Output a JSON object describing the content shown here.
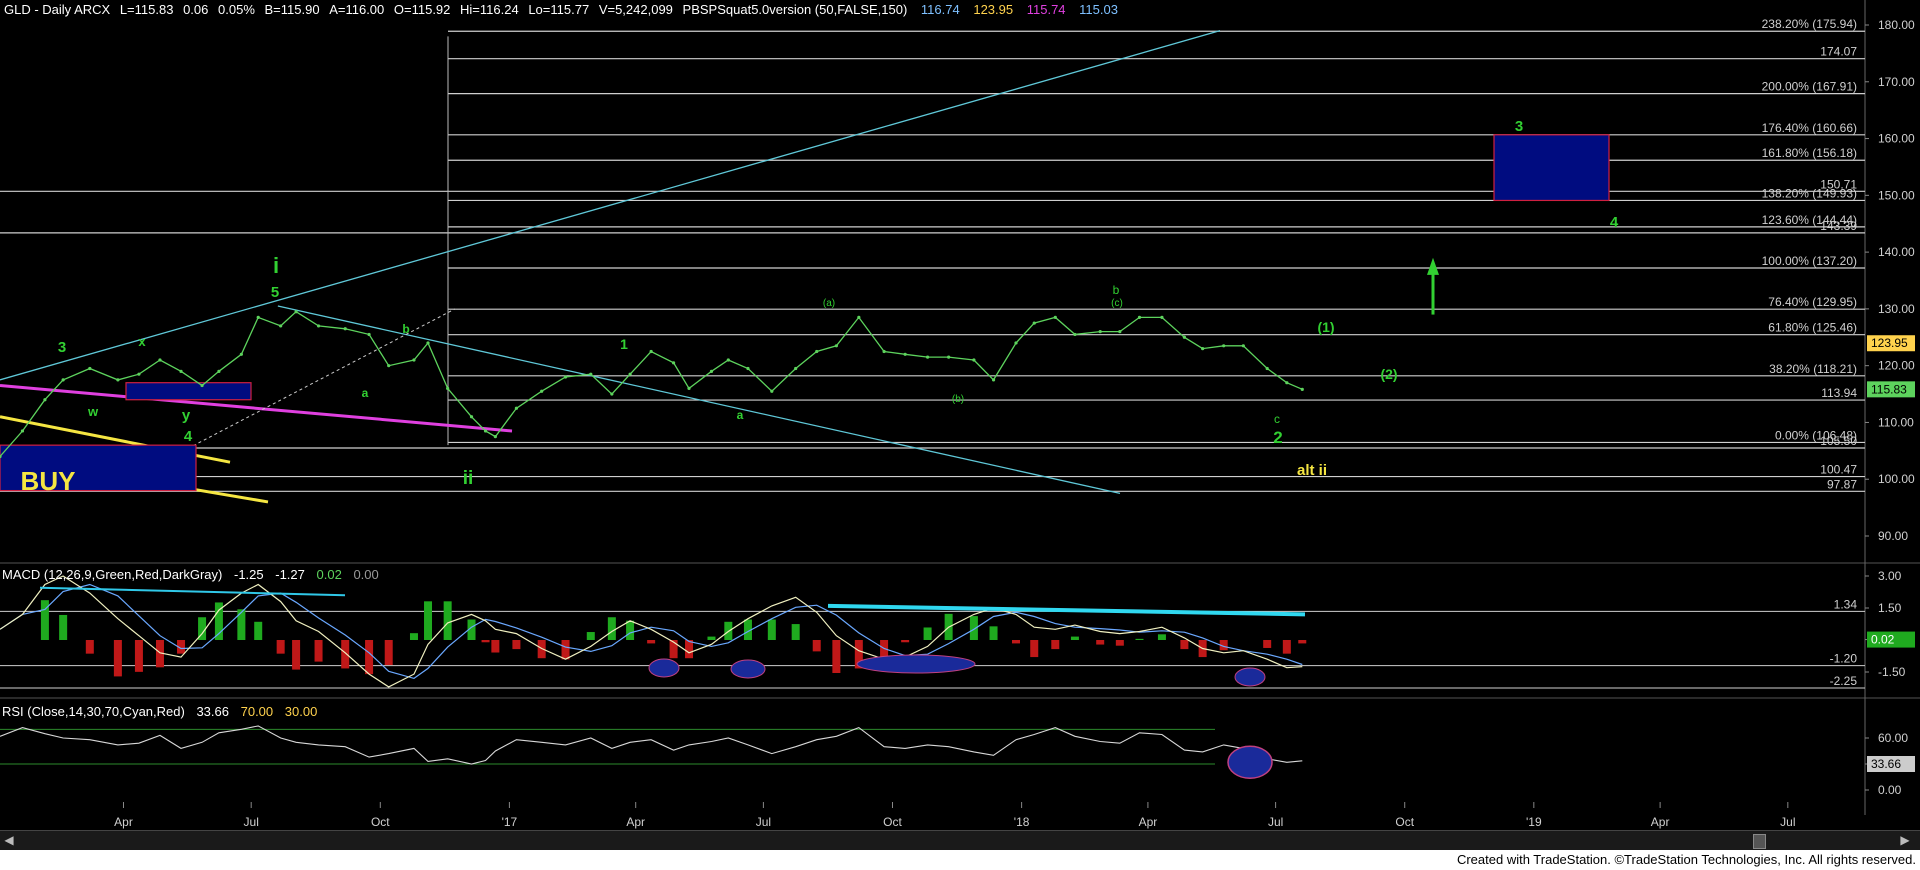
{
  "header": {
    "symbol": "GLD - Daily  ARCX",
    "fields": [
      "L=115.83",
      "0.06",
      "0.05%",
      "B=115.90",
      "A=116.00",
      "O=115.92",
      "Hi=116.24",
      "Lo=115.77",
      "V=5,242,099"
    ],
    "study": "PBSPSquat5.0version (50,FALSE,150)",
    "study_values": [
      "116.74",
      "123.95",
      "115.74",
      "115.03"
    ],
    "study_colors": [
      "#7ec0ff",
      "#ffd24d",
      "#e040e0",
      "#7ec0ff"
    ]
  },
  "macd_header": {
    "label": "MACD (12,26,9,Green,Red,DarkGray)",
    "values": [
      "-1.25",
      "-1.27",
      "0.02",
      "0.00"
    ]
  },
  "rsi_header": {
    "label": "RSI (Close,14,30,70,Cyan,Red)",
    "values": [
      "33.66",
      "70.00",
      "30.00"
    ]
  },
  "footer": {
    "credit": "Created with TradeStation. ©TradeStation Technologies, Inc. All rights reserved."
  },
  "colors": {
    "background": "#000000",
    "price": "#5dd35d",
    "axis_text": "#d0d0d0",
    "fib_text": "#d0d0d0",
    "trend": "#5fc8d8",
    "magenta": "#e040e0",
    "yellow": "#f5e642",
    "target_box": "#000c80",
    "wave_green": "#32d032"
  },
  "chart_data": [
    {
      "type": "line",
      "panel": "price",
      "series_name": "GLD",
      "x": [
        "2016-01-04",
        "2016-01-20",
        "2016-02-05",
        "2016-02-18",
        "2016-03-08",
        "2016-03-28",
        "2016-04-12",
        "2016-04-27",
        "2016-05-12",
        "2016-05-27",
        "2016-06-08",
        "2016-06-24",
        "2016-07-06",
        "2016-07-22",
        "2016-08-02",
        "2016-08-18",
        "2016-09-06",
        "2016-09-23",
        "2016-10-07",
        "2016-10-25",
        "2016-11-04",
        "2016-11-18",
        "2016-12-05",
        "2016-12-15",
        "2016-12-22",
        "2017-01-06",
        "2017-01-24",
        "2017-02-10",
        "2017-02-28",
        "2017-03-15",
        "2017-03-28",
        "2017-04-12",
        "2017-04-28",
        "2017-05-09",
        "2017-05-25",
        "2017-06-06",
        "2017-06-20",
        "2017-07-07",
        "2017-07-24",
        "2017-08-08",
        "2017-08-22",
        "2017-09-07",
        "2017-09-25",
        "2017-10-10",
        "2017-10-26",
        "2017-11-10",
        "2017-11-28",
        "2017-12-12",
        "2017-12-28",
        "2018-01-10",
        "2018-01-25",
        "2018-02-08",
        "2018-02-26",
        "2018-03-12",
        "2018-03-26",
        "2018-04-11",
        "2018-04-27",
        "2018-05-10",
        "2018-05-25",
        "2018-06-08",
        "2018-06-25",
        "2018-07-09",
        "2018-07-20"
      ],
      "values": [
        104,
        108.5,
        114,
        117.5,
        119.5,
        117.5,
        118.5,
        121,
        119,
        116.5,
        119,
        122,
        128.5,
        127,
        129.5,
        127,
        126.5,
        125.5,
        120,
        121,
        124,
        116,
        111,
        108.5,
        107.5,
        112.5,
        115.5,
        118,
        118.5,
        115,
        118.5,
        122.5,
        120.5,
        116,
        119,
        121,
        119.5,
        115.5,
        119.5,
        122.5,
        123.5,
        128.5,
        122.5,
        122,
        121.5,
        121.5,
        121,
        117.5,
        124,
        127.5,
        128.5,
        125.5,
        126,
        126,
        128.5,
        128.5,
        125,
        123,
        123.5,
        123.5,
        119.5,
        117,
        115.83
      ]
    },
    {
      "type": "line",
      "panel": "price",
      "y_axis_ticks": [
        90,
        100,
        110,
        120,
        130,
        140,
        150,
        160,
        170,
        180
      ],
      "y_axis_highlight": [
        {
          "label": "123.95",
          "color": "#ffd24d"
        },
        {
          "label": "115.83",
          "color": "#5dd35d"
        }
      ],
      "x_axis_ticks": [
        "Apr",
        "Jul",
        "Oct",
        "'17",
        "Apr",
        "Jul",
        "Oct",
        "'18",
        "Apr",
        "Jul",
        "Oct",
        "'19",
        "Apr",
        "Jul"
      ],
      "fib_levels": [
        {
          "value": 178.9,
          "label": "238.20% (175.94)"
        },
        {
          "value": 174.07,
          "label": "174.07"
        },
        {
          "value": 167.91,
          "label": "200.00% (167.91)"
        },
        {
          "value": 160.66,
          "label": "176.40% (160.66)"
        },
        {
          "value": 156.18,
          "label": "161.80% (156.18)"
        },
        {
          "value": 150.71,
          "label": "150.71"
        },
        {
          "value": 149.1,
          "label": "138.20% (149.93)"
        },
        {
          "value": 144.44,
          "label": "123.60% (144.44)"
        },
        {
          "value": 143.39,
          "label": "143.39"
        },
        {
          "value": 137.2,
          "label": "100.00% (137.20)"
        },
        {
          "value": 129.95,
          "label": "76.40% (129.95)"
        },
        {
          "value": 125.46,
          "label": "61.80% (125.46)"
        },
        {
          "value": 118.21,
          "label": "38.20% (118.21)"
        },
        {
          "value": 113.94,
          "label": "113.94"
        },
        {
          "value": 106.48,
          "label": "0.00% (106.48)"
        },
        {
          "value": 105.5,
          "label": "105.50"
        },
        {
          "value": 100.47,
          "label": "100.47"
        },
        {
          "value": 97.87,
          "label": "97.87"
        }
      ],
      "wave_labels": [
        "3",
        "x",
        "w",
        "y",
        "4",
        "5",
        "i",
        "a",
        "b",
        "ii",
        "(a)",
        "1",
        "a",
        "(b)",
        "b",
        "(c)",
        "c",
        "2",
        "(1)",
        "(2)",
        "3",
        "4",
        "alt ii",
        "BUY"
      ]
    },
    {
      "type": "line",
      "panel": "macd",
      "y_axis_ticks": [
        3.0,
        1.5,
        0.02,
        -1.5
      ],
      "tick_labels": [
        "3.00",
        "1.50",
        "0.02",
        "-1.50"
      ],
      "levels": [
        {
          "value": 1.34,
          "label": "1.34"
        },
        {
          "value": -1.2,
          "label": "-1.20"
        },
        {
          "value": -2.25,
          "label": "-2.25"
        }
      ]
    },
    {
      "type": "line",
      "panel": "rsi",
      "y_axis_ticks": [
        60,
        30,
        0
      ],
      "tick_labels": [
        "60.00",
        "33.66",
        "0.00"
      ],
      "levels": [
        70,
        30
      ]
    }
  ]
}
